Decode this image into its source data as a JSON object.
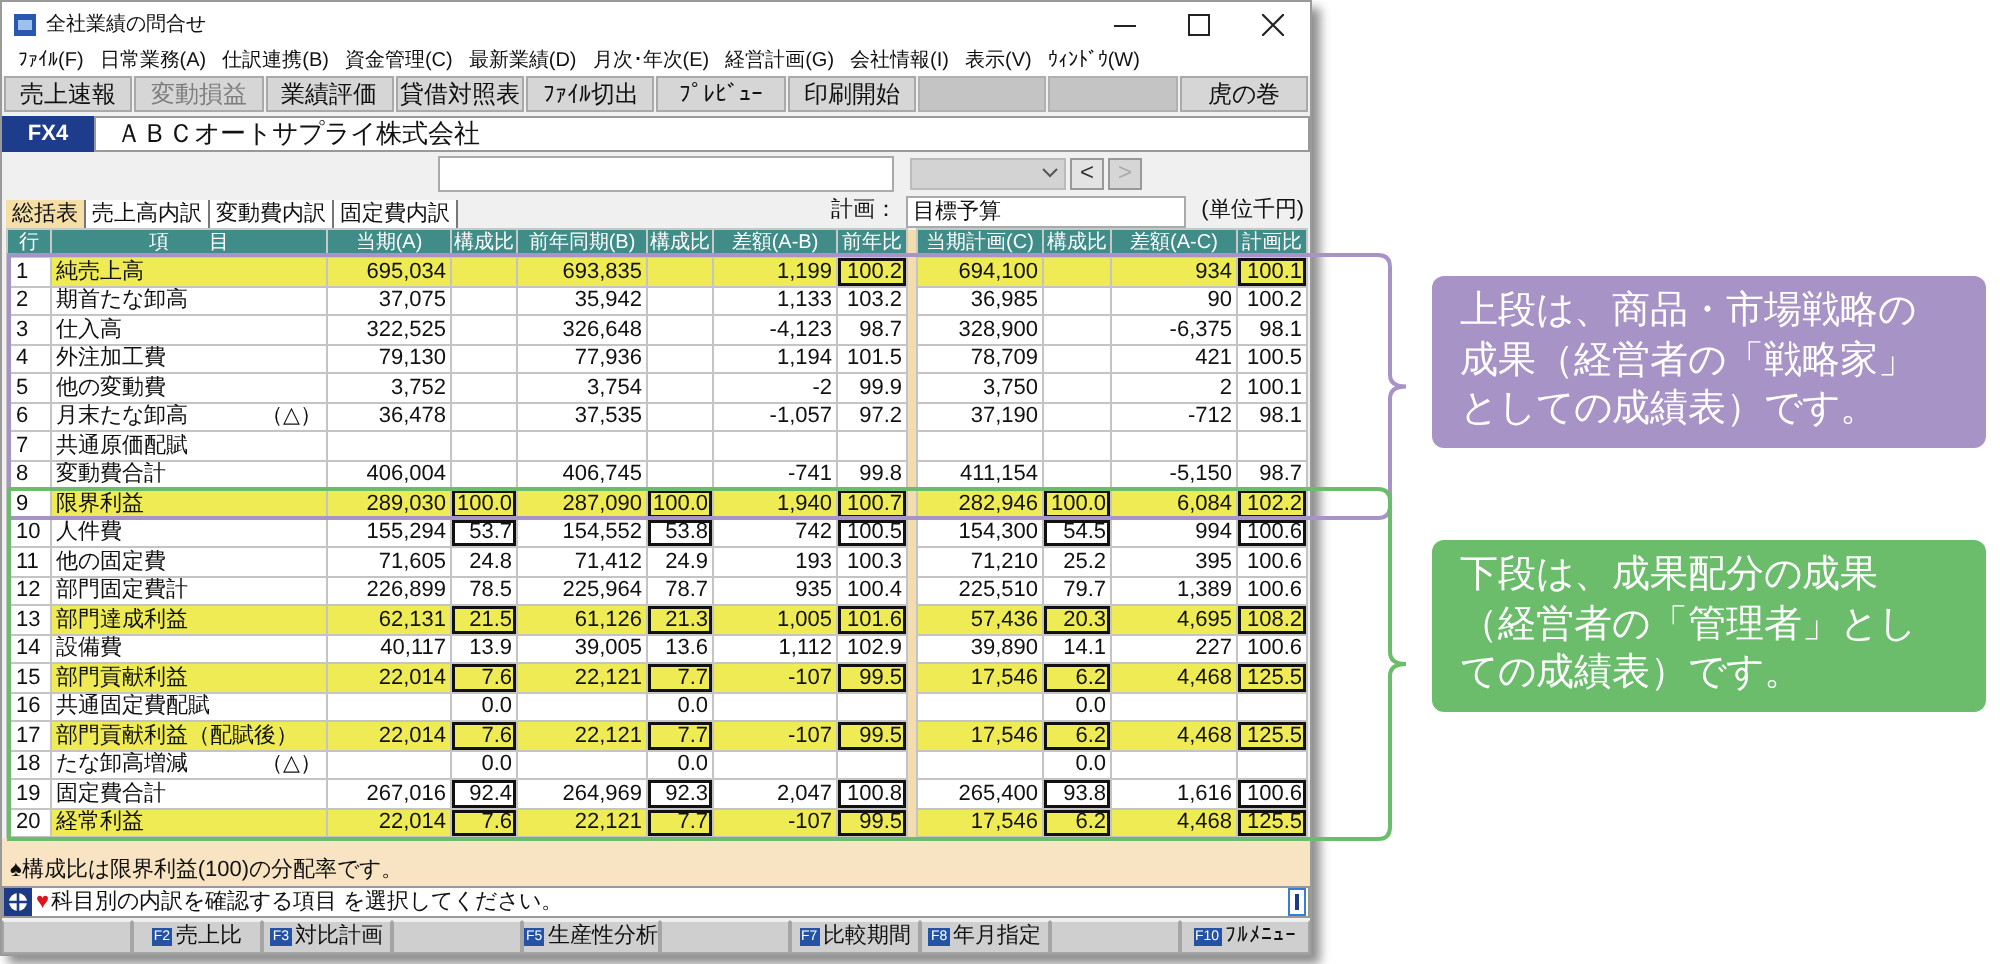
{
  "window": {
    "title": "全社業績の問合せ"
  },
  "menu": [
    "ﾌｧｲﾙ(F)",
    "日常業務(A)",
    "仕訳連携(B)",
    "資金管理(C)",
    "最新業績(D)",
    "月次･年次(E)",
    "経営計画(G)",
    "会社情報(I)",
    "表示(V)",
    "ｳｨﾝﾄﾞｳ(W)"
  ],
  "toolbar": [
    {
      "kind": "button",
      "label": "売上速報",
      "disabled": false
    },
    {
      "kind": "button",
      "label": "変動損益",
      "disabled": true
    },
    {
      "kind": "button",
      "label": "業績評価",
      "disabled": false
    },
    {
      "kind": "button",
      "label": "貸借対照表",
      "disabled": false
    },
    {
      "kind": "button",
      "label": "ﾌｧｲﾙ切出",
      "disabled": false
    },
    {
      "kind": "button",
      "label": "ﾌﾟﾚﾋﾞｭｰ",
      "disabled": false
    },
    {
      "kind": "button",
      "label": "印刷開始",
      "disabled": false
    },
    {
      "kind": "blank"
    },
    {
      "kind": "blank"
    },
    {
      "kind": "button",
      "label": "虎の巻",
      "disabled": false
    }
  ],
  "company": {
    "code": "FX4",
    "name": "ＡＢＣオートサプライ株式会社"
  },
  "navigation": [
    {
      "label": "<",
      "disabled": false
    },
    {
      "label": ">",
      "disabled": true
    }
  ],
  "tabs": [
    {
      "label": "総括表",
      "selected": true
    },
    {
      "label": "売上高内訳",
      "selected": false
    },
    {
      "label": "変動費内訳",
      "selected": false
    },
    {
      "label": "固定費内訳",
      "selected": false
    }
  ],
  "plan": {
    "label": "計画：",
    "value": "目標予算",
    "unit": "(単位千円)"
  },
  "table": {
    "number_header": "行",
    "item_header": "項　　目",
    "columns": [
      "当期(A)",
      "構成比",
      "前年同期(B)",
      "構成比",
      "差額(A-B)",
      "前年比",
      "当期計画(C)",
      "構成比",
      "差額(A-C)",
      "計画比"
    ],
    "rows": [
      {
        "no": "1",
        "label": "純売上高",
        "highlight": true,
        "cells": [
          {
            "kind": "value",
            "text": "695,034"
          },
          {
            "kind": "empty"
          },
          {
            "kind": "value",
            "text": "693,835"
          },
          {
            "kind": "empty"
          },
          {
            "kind": "value",
            "text": "1,199"
          },
          {
            "kind": "value",
            "text": "100.2",
            "boxed": true
          },
          {
            "kind": "value",
            "text": "694,100"
          },
          {
            "kind": "empty"
          },
          {
            "kind": "value",
            "text": "934"
          },
          {
            "kind": "value",
            "text": "100.1",
            "boxed": true
          }
        ]
      },
      {
        "no": "2",
        "label": "期首たな卸高",
        "highlight": false,
        "cells": [
          {
            "kind": "value",
            "text": "37,075"
          },
          {
            "kind": "empty"
          },
          {
            "kind": "value",
            "text": "35,942"
          },
          {
            "kind": "empty"
          },
          {
            "kind": "value",
            "text": "1,133"
          },
          {
            "kind": "value",
            "text": "103.2",
            "boxed": false
          },
          {
            "kind": "value",
            "text": "36,985"
          },
          {
            "kind": "empty"
          },
          {
            "kind": "value",
            "text": "90"
          },
          {
            "kind": "value",
            "text": "100.2",
            "boxed": false
          }
        ]
      },
      {
        "no": "3",
        "label": "仕入高",
        "highlight": false,
        "cells": [
          {
            "kind": "value",
            "text": "322,525"
          },
          {
            "kind": "empty"
          },
          {
            "kind": "value",
            "text": "326,648"
          },
          {
            "kind": "empty"
          },
          {
            "kind": "value",
            "text": "-4,123"
          },
          {
            "kind": "value",
            "text": "98.7",
            "boxed": false
          },
          {
            "kind": "value",
            "text": "328,900"
          },
          {
            "kind": "empty"
          },
          {
            "kind": "value",
            "text": "-6,375"
          },
          {
            "kind": "value",
            "text": "98.1",
            "boxed": false
          }
        ]
      },
      {
        "no": "4",
        "label": "外注加工費",
        "highlight": false,
        "cells": [
          {
            "kind": "value",
            "text": "79,130"
          },
          {
            "kind": "empty"
          },
          {
            "kind": "value",
            "text": "77,936"
          },
          {
            "kind": "empty"
          },
          {
            "kind": "value",
            "text": "1,194"
          },
          {
            "kind": "value",
            "text": "101.5",
            "boxed": false
          },
          {
            "kind": "value",
            "text": "78,709"
          },
          {
            "kind": "empty"
          },
          {
            "kind": "value",
            "text": "421"
          },
          {
            "kind": "value",
            "text": "100.5",
            "boxed": false
          }
        ]
      },
      {
        "no": "5",
        "label": "他の変動費",
        "highlight": false,
        "cells": [
          {
            "kind": "value",
            "text": "3,752"
          },
          {
            "kind": "empty"
          },
          {
            "kind": "value",
            "text": "3,754"
          },
          {
            "kind": "empty"
          },
          {
            "kind": "value",
            "text": "-2"
          },
          {
            "kind": "value",
            "text": "99.9",
            "boxed": false
          },
          {
            "kind": "value",
            "text": "3,750"
          },
          {
            "kind": "empty"
          },
          {
            "kind": "value",
            "text": "2"
          },
          {
            "kind": "value",
            "text": "100.1",
            "boxed": false
          }
        ]
      },
      {
        "no": "6",
        "label": "月末たな卸高",
        "note": "（△）",
        "highlight": false,
        "cells": [
          {
            "kind": "value",
            "text": "36,478"
          },
          {
            "kind": "empty"
          },
          {
            "kind": "value",
            "text": "37,535"
          },
          {
            "kind": "empty"
          },
          {
            "kind": "value",
            "text": "-1,057"
          },
          {
            "kind": "value",
            "text": "97.2",
            "boxed": false
          },
          {
            "kind": "value",
            "text": "37,190"
          },
          {
            "kind": "empty"
          },
          {
            "kind": "value",
            "text": "-712"
          },
          {
            "kind": "value",
            "text": "98.1",
            "boxed": false
          }
        ]
      },
      {
        "no": "7",
        "label": "共通原価配賦",
        "highlight": false,
        "cells": [
          {
            "kind": "empty"
          },
          {
            "kind": "empty"
          },
          {
            "kind": "empty"
          },
          {
            "kind": "empty"
          },
          {
            "kind": "empty"
          },
          {
            "kind": "empty"
          },
          {
            "kind": "empty"
          },
          {
            "kind": "empty"
          },
          {
            "kind": "empty"
          },
          {
            "kind": "empty"
          }
        ]
      },
      {
        "no": "8",
        "label": "変動費合計",
        "highlight": false,
        "cells": [
          {
            "kind": "value",
            "text": "406,004"
          },
          {
            "kind": "empty"
          },
          {
            "kind": "value",
            "text": "406,745"
          },
          {
            "kind": "empty"
          },
          {
            "kind": "value",
            "text": "-741"
          },
          {
            "kind": "value",
            "text": "99.8",
            "boxed": false
          },
          {
            "kind": "value",
            "text": "411,154"
          },
          {
            "kind": "empty"
          },
          {
            "kind": "value",
            "text": "-5,150"
          },
          {
            "kind": "value",
            "text": "98.7",
            "boxed": false
          }
        ]
      },
      {
        "no": "9",
        "label": "限界利益",
        "highlight": true,
        "cells": [
          {
            "kind": "value",
            "text": "289,030"
          },
          {
            "kind": "value",
            "text": "100.0",
            "boxed": true
          },
          {
            "kind": "value",
            "text": "287,090"
          },
          {
            "kind": "value",
            "text": "100.0",
            "boxed": true
          },
          {
            "kind": "value",
            "text": "1,940"
          },
          {
            "kind": "value",
            "text": "100.7",
            "boxed": true
          },
          {
            "kind": "value",
            "text": "282,946"
          },
          {
            "kind": "value",
            "text": "100.0",
            "boxed": true
          },
          {
            "kind": "value",
            "text": "6,084"
          },
          {
            "kind": "value",
            "text": "102.2",
            "boxed": true
          }
        ]
      },
      {
        "no": "10",
        "label": "人件費",
        "highlight": false,
        "cells": [
          {
            "kind": "value",
            "text": "155,294"
          },
          {
            "kind": "value",
            "text": "53.7",
            "boxed": true
          },
          {
            "kind": "value",
            "text": "154,552"
          },
          {
            "kind": "value",
            "text": "53.8",
            "boxed": true
          },
          {
            "kind": "value",
            "text": "742"
          },
          {
            "kind": "value",
            "text": "100.5",
            "boxed": true
          },
          {
            "kind": "value",
            "text": "154,300"
          },
          {
            "kind": "value",
            "text": "54.5",
            "boxed": true
          },
          {
            "kind": "value",
            "text": "994"
          },
          {
            "kind": "value",
            "text": "100.6",
            "boxed": true
          }
        ]
      },
      {
        "no": "11",
        "label": "他の固定費",
        "highlight": false,
        "cells": [
          {
            "kind": "value",
            "text": "71,605"
          },
          {
            "kind": "value",
            "text": "24.8",
            "boxed": false
          },
          {
            "kind": "value",
            "text": "71,412"
          },
          {
            "kind": "value",
            "text": "24.9",
            "boxed": false
          },
          {
            "kind": "value",
            "text": "193"
          },
          {
            "kind": "value",
            "text": "100.3",
            "boxed": false
          },
          {
            "kind": "value",
            "text": "71,210"
          },
          {
            "kind": "value",
            "text": "25.2",
            "boxed": false
          },
          {
            "kind": "value",
            "text": "395"
          },
          {
            "kind": "value",
            "text": "100.6",
            "boxed": false
          }
        ]
      },
      {
        "no": "12",
        "label": "部門固定費計",
        "highlight": false,
        "cells": [
          {
            "kind": "value",
            "text": "226,899"
          },
          {
            "kind": "value",
            "text": "78.5",
            "boxed": false
          },
          {
            "kind": "value",
            "text": "225,964"
          },
          {
            "kind": "value",
            "text": "78.7",
            "boxed": false
          },
          {
            "kind": "value",
            "text": "935"
          },
          {
            "kind": "value",
            "text": "100.4",
            "boxed": false
          },
          {
            "kind": "value",
            "text": "225,510"
          },
          {
            "kind": "value",
            "text": "79.7",
            "boxed": false
          },
          {
            "kind": "value",
            "text": "1,389"
          },
          {
            "kind": "value",
            "text": "100.6",
            "boxed": false
          }
        ]
      },
      {
        "no": "13",
        "label": "部門達成利益",
        "highlight": true,
        "cells": [
          {
            "kind": "value",
            "text": "62,131"
          },
          {
            "kind": "value",
            "text": "21.5",
            "boxed": true
          },
          {
            "kind": "value",
            "text": "61,126"
          },
          {
            "kind": "value",
            "text": "21.3",
            "boxed": true
          },
          {
            "kind": "value",
            "text": "1,005"
          },
          {
            "kind": "value",
            "text": "101.6",
            "boxed": true
          },
          {
            "kind": "value",
            "text": "57,436"
          },
          {
            "kind": "value",
            "text": "20.3",
            "boxed": true
          },
          {
            "kind": "value",
            "text": "4,695"
          },
          {
            "kind": "value",
            "text": "108.2",
            "boxed": true
          }
        ]
      },
      {
        "no": "14",
        "label": "設備費",
        "highlight": false,
        "cells": [
          {
            "kind": "value",
            "text": "40,117"
          },
          {
            "kind": "value",
            "text": "13.9",
            "boxed": false
          },
          {
            "kind": "value",
            "text": "39,005"
          },
          {
            "kind": "value",
            "text": "13.6",
            "boxed": false
          },
          {
            "kind": "value",
            "text": "1,112"
          },
          {
            "kind": "value",
            "text": "102.9",
            "boxed": false
          },
          {
            "kind": "value",
            "text": "39,890"
          },
          {
            "kind": "value",
            "text": "14.1",
            "boxed": false
          },
          {
            "kind": "value",
            "text": "227"
          },
          {
            "kind": "value",
            "text": "100.6",
            "boxed": false
          }
        ]
      },
      {
        "no": "15",
        "label": "部門貢献利益",
        "highlight": true,
        "cells": [
          {
            "kind": "value",
            "text": "22,014"
          },
          {
            "kind": "value",
            "text": "7.6",
            "boxed": true
          },
          {
            "kind": "value",
            "text": "22,121"
          },
          {
            "kind": "value",
            "text": "7.7",
            "boxed": true
          },
          {
            "kind": "value",
            "text": "-107"
          },
          {
            "kind": "value",
            "text": "99.5",
            "boxed": true
          },
          {
            "kind": "value",
            "text": "17,546"
          },
          {
            "kind": "value",
            "text": "6.2",
            "boxed": true
          },
          {
            "kind": "value",
            "text": "4,468"
          },
          {
            "kind": "value",
            "text": "125.5",
            "boxed": true
          }
        ]
      },
      {
        "no": "16",
        "label": "共通固定費配賦",
        "highlight": false,
        "cells": [
          {
            "kind": "empty"
          },
          {
            "kind": "value",
            "text": "0.0",
            "boxed": false
          },
          {
            "kind": "empty"
          },
          {
            "kind": "value",
            "text": "0.0",
            "boxed": false
          },
          {
            "kind": "empty"
          },
          {
            "kind": "empty"
          },
          {
            "kind": "empty"
          },
          {
            "kind": "value",
            "text": "0.0",
            "boxed": false
          },
          {
            "kind": "empty"
          },
          {
            "kind": "empty"
          }
        ]
      },
      {
        "no": "17",
        "label": "部門貢献利益（配賦後）",
        "highlight": true,
        "cells": [
          {
            "kind": "value",
            "text": "22,014"
          },
          {
            "kind": "value",
            "text": "7.6",
            "boxed": true
          },
          {
            "kind": "value",
            "text": "22,121"
          },
          {
            "kind": "value",
            "text": "7.7",
            "boxed": true
          },
          {
            "kind": "value",
            "text": "-107"
          },
          {
            "kind": "value",
            "text": "99.5",
            "boxed": true
          },
          {
            "kind": "value",
            "text": "17,546"
          },
          {
            "kind": "value",
            "text": "6.2",
            "boxed": true
          },
          {
            "kind": "value",
            "text": "4,468"
          },
          {
            "kind": "value",
            "text": "125.5",
            "boxed": true
          }
        ]
      },
      {
        "no": "18",
        "label": "たな卸高増減",
        "note": "（△）",
        "highlight": false,
        "cells": [
          {
            "kind": "empty"
          },
          {
            "kind": "value",
            "text": "0.0",
            "boxed": false
          },
          {
            "kind": "empty"
          },
          {
            "kind": "value",
            "text": "0.0",
            "boxed": false
          },
          {
            "kind": "empty"
          },
          {
            "kind": "empty"
          },
          {
            "kind": "empty"
          },
          {
            "kind": "value",
            "text": "0.0",
            "boxed": false
          },
          {
            "kind": "empty"
          },
          {
            "kind": "empty"
          }
        ]
      },
      {
        "no": "19",
        "label": "固定費合計",
        "highlight": false,
        "cells": [
          {
            "kind": "value",
            "text": "267,016"
          },
          {
            "kind": "value",
            "text": "92.4",
            "boxed": true
          },
          {
            "kind": "value",
            "text": "264,969"
          },
          {
            "kind": "value",
            "text": "92.3",
            "boxed": true
          },
          {
            "kind": "value",
            "text": "2,047"
          },
          {
            "kind": "value",
            "text": "100.8",
            "boxed": true
          },
          {
            "kind": "value",
            "text": "265,400"
          },
          {
            "kind": "value",
            "text": "93.8",
            "boxed": true
          },
          {
            "kind": "value",
            "text": "1,616"
          },
          {
            "kind": "value",
            "text": "100.6",
            "boxed": true
          }
        ]
      },
      {
        "no": "20",
        "label": "経常利益",
        "highlight": true,
        "cells": [
          {
            "kind": "value",
            "text": "22,014"
          },
          {
            "kind": "value",
            "text": "7.6",
            "boxed": true
          },
          {
            "kind": "value",
            "text": "22,121"
          },
          {
            "kind": "value",
            "text": "7.7",
            "boxed": true
          },
          {
            "kind": "value",
            "text": "-107"
          },
          {
            "kind": "value",
            "text": "99.5",
            "boxed": true
          },
          {
            "kind": "value",
            "text": "17,546"
          },
          {
            "kind": "value",
            "text": "6.2",
            "boxed": true
          },
          {
            "kind": "value",
            "text": "4,468"
          },
          {
            "kind": "value",
            "text": "125.5",
            "boxed": true
          }
        ]
      }
    ]
  },
  "note": "♠構成比は限界利益(100)の分配率です。",
  "status": {
    "mark": "♥",
    "text": "科目別の内訳を確認する項目 を選択してください。"
  },
  "function_keys": [
    {
      "kind": "blank"
    },
    {
      "kind": "key",
      "key": "F2",
      "label": "売上比"
    },
    {
      "kind": "key",
      "key": "F3",
      "label": "対比計画"
    },
    {
      "kind": "blank"
    },
    {
      "kind": "key",
      "key": "F5",
      "label": "生産性分析"
    },
    {
      "kind": "blank"
    },
    {
      "kind": "key",
      "key": "F7",
      "label": "比較期間"
    },
    {
      "kind": "key",
      "key": "F8",
      "label": "年月指定"
    },
    {
      "kind": "blank"
    },
    {
      "kind": "key",
      "key": "F10",
      "label": "ﾌﾙﾒﾆｭｰ"
    }
  ],
  "callouts": [
    {
      "text": "上段は、商品・市場戦略の成果（経営者の「戦略家」としての成績表）です。",
      "color": "#a893c6"
    },
    {
      "text": "下段は、成果配分の成果（経営者の「管理者」としての成績表）です。",
      "color": "#6bbd6c"
    }
  ]
}
